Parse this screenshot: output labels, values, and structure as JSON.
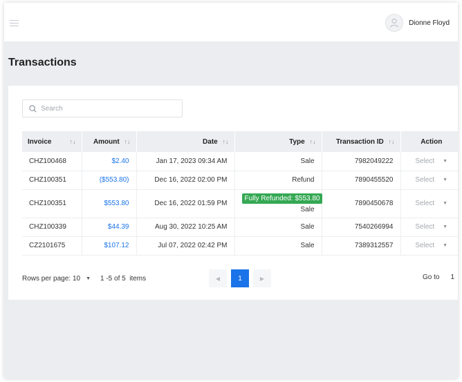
{
  "header": {
    "user_name": "Dionne Floyd"
  },
  "page": {
    "title": "Transactions"
  },
  "search": {
    "placeholder": "Search",
    "value": ""
  },
  "table": {
    "columns": {
      "invoice": "Invoice",
      "amount": "Amount",
      "date": "Date",
      "type": "Type",
      "transaction_id": "Transaction ID",
      "action": "Action"
    },
    "sort_glyph": "↑↓",
    "rows": [
      {
        "invoice": "CHZ100468",
        "amount": "$2.40",
        "date": "Jan 17, 2023 09:34 AM",
        "badge": "",
        "type": "Sale",
        "transaction_id": "7982049222",
        "action": "Select"
      },
      {
        "invoice": "CHZ100351",
        "amount": "($553.80)",
        "date": "Dec 16, 2022 02:00 PM",
        "badge": "",
        "type": "Refund",
        "transaction_id": "7890455520",
        "action": "Select"
      },
      {
        "invoice": "CHZ100351",
        "amount": "$553.80",
        "date": "Dec 16, 2022 01:59 PM",
        "badge": "Fully Refunded: $553.80",
        "type": "Sale",
        "transaction_id": "7890450678",
        "action": "Select"
      },
      {
        "invoice": "CHZ100339",
        "amount": "$44.39",
        "date": "Aug 30, 2022 10:25 AM",
        "badge": "",
        "type": "Sale",
        "transaction_id": "7540266994",
        "action": "Select"
      },
      {
        "invoice": "CZ2101675",
        "amount": "$107.12",
        "date": "Jul 07, 2022 02:42 PM",
        "badge": "",
        "type": "Sale",
        "transaction_id": "7389312557",
        "action": "Select"
      }
    ]
  },
  "pagination": {
    "rows_per_page_label": "Rows per page:",
    "rows_per_page_value": "10",
    "items_text": "1 -5 of 5  items",
    "current_page": "1",
    "goto_label": "Go to",
    "goto_value": "1"
  },
  "colors": {
    "accent": "#1a73e8",
    "badge_green": "#34a853",
    "page_bg": "#ebedf0"
  },
  "icons": {
    "menu": "hamburger-menu-icon",
    "avatar": "user-avatar-icon",
    "search": "search-icon",
    "sort": "sort-arrows-icon",
    "dropdown": "caret-down-icon",
    "prev": "chevron-left-icon",
    "next": "chevron-right-icon"
  }
}
